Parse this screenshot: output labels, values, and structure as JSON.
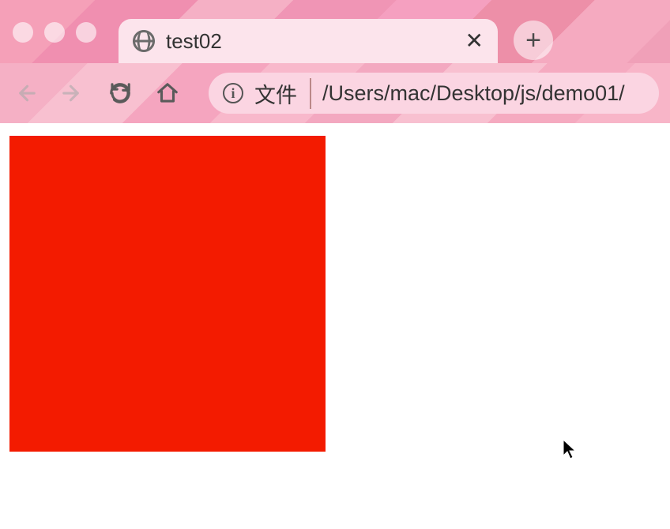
{
  "tab": {
    "title": "test02",
    "close_glyph": "✕"
  },
  "new_tab_glyph": "+",
  "address": {
    "protocol_label": "文件",
    "path": "/Users/mac/Desktop/js/demo01/",
    "info_glyph": "i"
  },
  "content": {
    "box_color": "#f31b00"
  },
  "icons": {
    "globe": "globe-icon",
    "back": "back-icon",
    "forward": "forward-icon",
    "reload": "reload-icon",
    "home": "home-icon",
    "plus": "plus-icon",
    "close": "close-icon",
    "info": "info-icon"
  }
}
